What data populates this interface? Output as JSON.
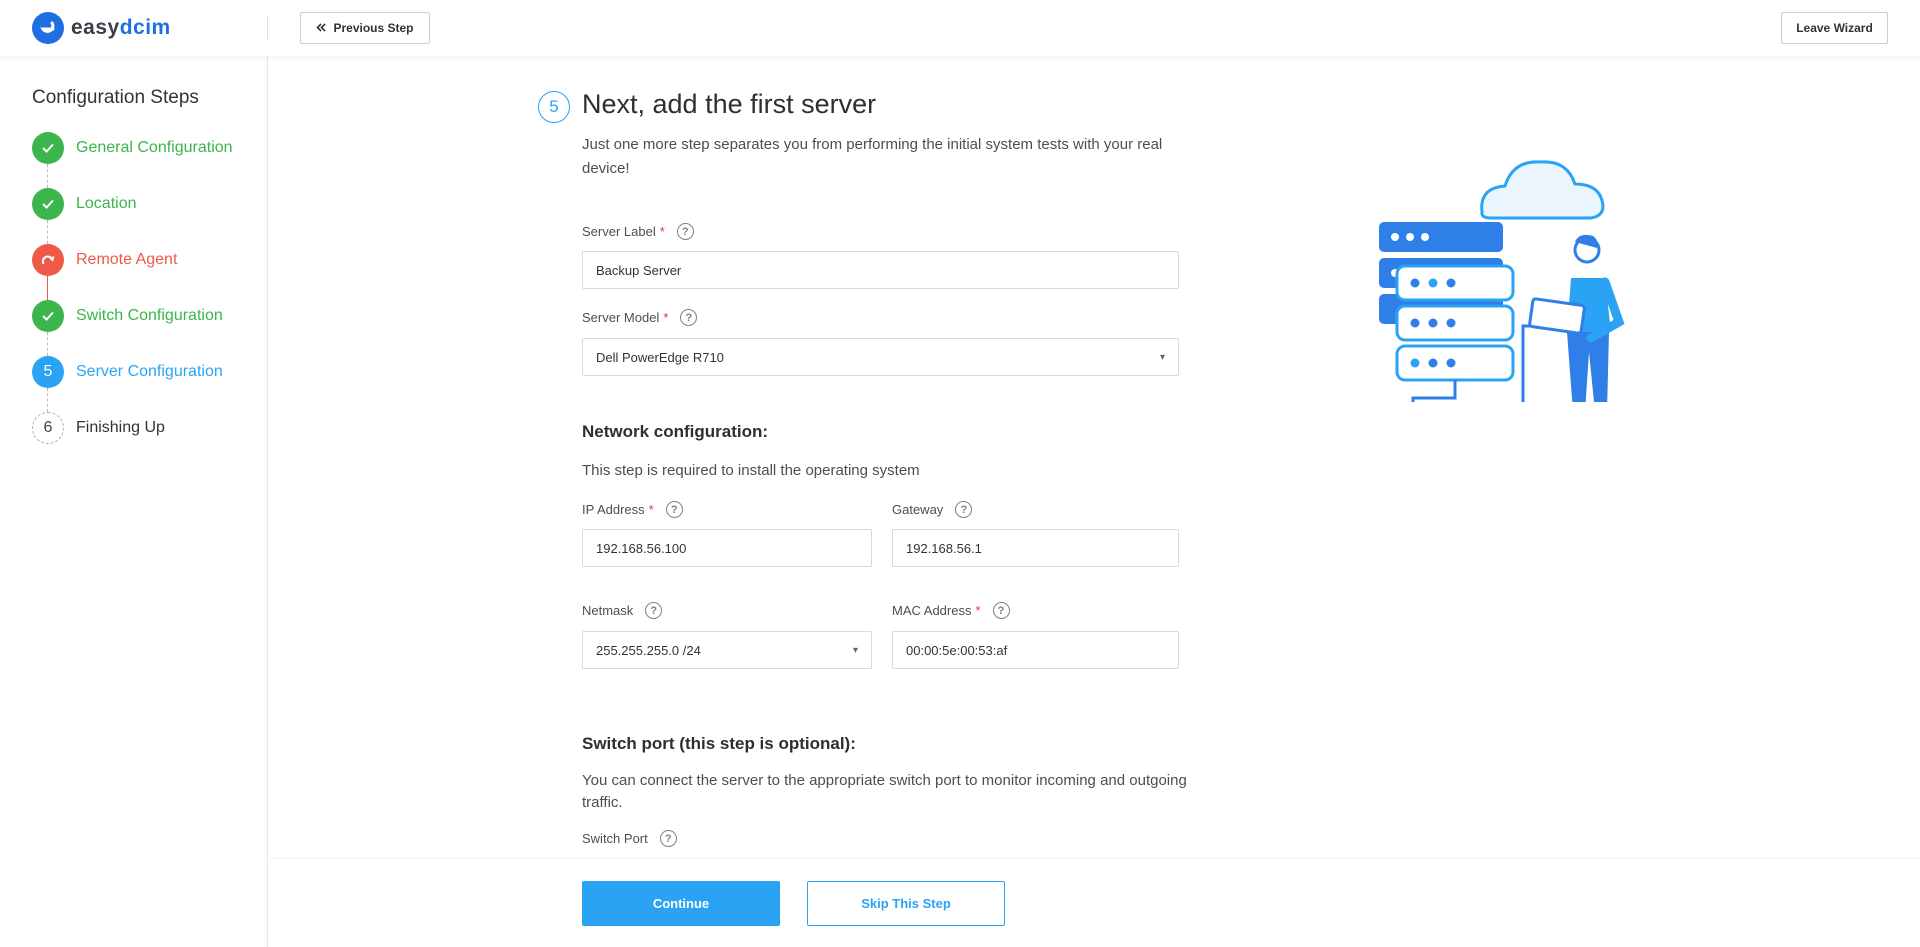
{
  "header": {
    "logo_part1": "easy",
    "logo_part2": "dcim",
    "prev_label": "Previous Step",
    "leave_label": "Leave Wizard"
  },
  "sidebar": {
    "title": "Configuration Steps",
    "steps": [
      {
        "marker": "",
        "label": "General Configuration",
        "state": "done"
      },
      {
        "marker": "",
        "label": "Location",
        "state": "done"
      },
      {
        "marker": "",
        "label": "Remote Agent",
        "state": "warning"
      },
      {
        "marker": "",
        "label": "Switch Configuration",
        "state": "done"
      },
      {
        "marker": "5",
        "label": "Server Configuration",
        "state": "active"
      },
      {
        "marker": "6",
        "label": "Finishing Up",
        "state": "todo"
      }
    ]
  },
  "main": {
    "step_number": "5",
    "title": "Next, add the first server",
    "subtitle": "Just one more step separates you from performing the initial system tests with your real device!",
    "server_label": {
      "label": "Server Label",
      "value": "Backup Server"
    },
    "server_model": {
      "label": "Server Model",
      "value": "Dell PowerEdge R710"
    },
    "network": {
      "title": "Network configuration:",
      "desc": "This step is required to install the operating system",
      "ip": {
        "label": "IP Address",
        "value": "192.168.56.100"
      },
      "gateway": {
        "label": "Gateway",
        "value": "192.168.56.1"
      },
      "netmask": {
        "label": "Netmask",
        "value": "255.255.255.0 /24"
      },
      "mac": {
        "label": "MAC Address",
        "value": "00:00:5e:00:53:af"
      }
    },
    "switch": {
      "title": "Switch port (this step is optional):",
      "desc": "You can connect the server to the appropriate switch port to monitor incoming and outgoing traffic.",
      "port_label": "Switch Port"
    }
  },
  "footer": {
    "continue_label": "Continue",
    "skip_label": "Skip This Step"
  },
  "icons": {
    "check": "check-icon",
    "redo": "redo-icon",
    "help": "question-icon",
    "caret": "caret-down-icon",
    "prev": "double-chevron-left-icon"
  },
  "colors": {
    "accent": "#2aa3f5",
    "success": "#3cb54a",
    "warning": "#ef5a48",
    "brand": "#1f6fe0"
  }
}
